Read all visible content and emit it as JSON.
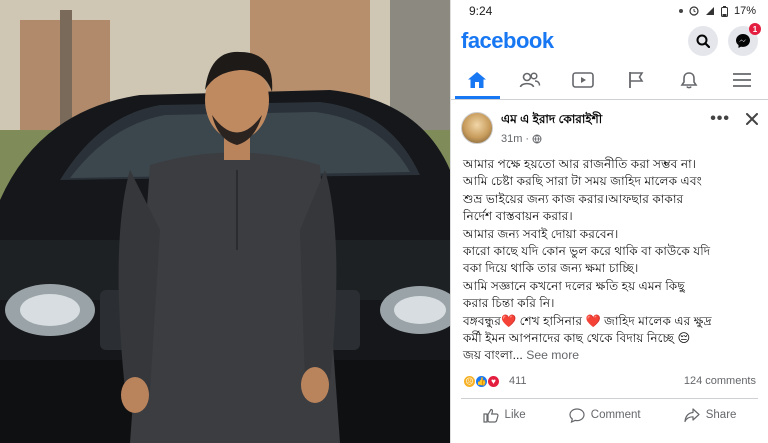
{
  "status_bar": {
    "time": "9:24",
    "battery": "17%"
  },
  "header": {
    "logo": "facebook",
    "messenger_badge": "1"
  },
  "nav": {
    "tabs": [
      "home-icon",
      "friends-icon",
      "video-icon",
      "flag-icon",
      "bell-icon",
      "menu-icon"
    ],
    "active": 0
  },
  "post": {
    "author": "এম এ ইরাদ কোরাইশী",
    "time": "31m",
    "lines": [
      "আমার পক্ষে হয়তো আর রাজনীতি করা সম্ভব না।",
      "আমি চেষ্টা করছি সারা টা সময় জাহিদ মালেক এবং",
      "শুভ্র ভাইয়ের জন্য কাজ করার।আফছার কাকার",
      "নির্দেশ বাস্তবায়ন করার।",
      "আমার জন্য সবাই দোয়া করবেন।",
      "কারো কাছে যদি কোন ভুল করে থাকি বা কাউকে যদি",
      "বকা দিয়ে থাকি তার জন্য ক্ষমা চাচ্ছি।",
      "আমি সজ্ঞানে কখনো দলের ক্ষতি হয় এমন কিছু",
      "করার চিন্তা করি নি।",
      "বঙ্গবন্ধুর❤️ শেখ হাসিনার ❤️ জাহিদ মালেক এর ক্ষুদ্র",
      "কর্মী ইমন আপনাদের কাছ থেকে বিদায় নিচ্ছে 😔"
    ],
    "last_line": "জয় বাংলা...",
    "see_more": "See more",
    "reactions_count": "411",
    "comments_count": "124 comments",
    "actions": {
      "like": "Like",
      "comment": "Comment",
      "share": "Share"
    }
  },
  "colors": {
    "brand": "#1877f2",
    "badge": "#e41e3f",
    "heart": "#e41e3f"
  }
}
